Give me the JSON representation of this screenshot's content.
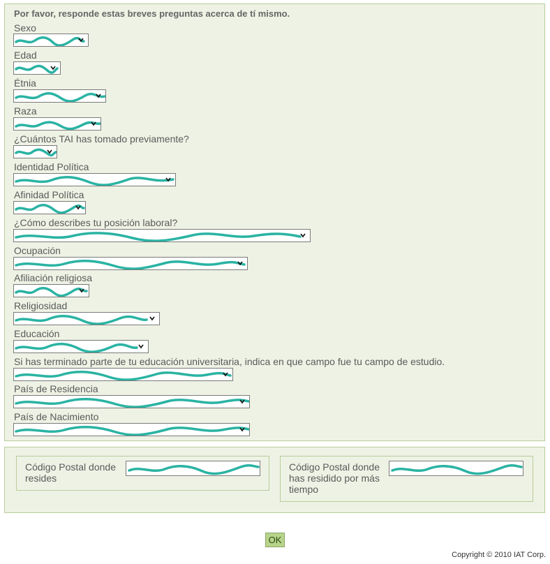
{
  "form": {
    "intro": "Por favor, responde estas breves preguntas acerca de tí mismo.",
    "questions": [
      {
        "label": "Sexo",
        "value": ""
      },
      {
        "label": "Edad",
        "value": ""
      },
      {
        "label": "Étnia",
        "value": ""
      },
      {
        "label": "Raza",
        "value": ""
      },
      {
        "label": "¿Cuántos TAI has tomado previamente?",
        "value": ""
      },
      {
        "label": "Identidad Política",
        "value": ""
      },
      {
        "label": "Afinidad Política",
        "value": ""
      },
      {
        "label": "¿Cómo describes tu posición laboral?",
        "value": ""
      },
      {
        "label": "Ocupación",
        "value": ""
      },
      {
        "label": "Afiliación religiosa",
        "value": ""
      },
      {
        "label": "Religiosidad",
        "value": ""
      },
      {
        "label": "Educación",
        "value": ""
      },
      {
        "label": "Si has terminado parte de tu educación universitaria, indica en que campo fue tu campo de estudio.",
        "value": ""
      },
      {
        "label": "País de Residencia",
        "value": ""
      },
      {
        "label": "País de Nacimiento",
        "value": ""
      }
    ]
  },
  "zip": {
    "current_label": "Código Postal donde resides",
    "longest_label": "Código Postal donde has residido por más tiempo",
    "current_value": "",
    "longest_value": ""
  },
  "buttons": {
    "ok_label": "OK"
  },
  "footer": {
    "copyright": "Copyright © 2010 IAT Corp."
  },
  "colors": {
    "panel_background": "#eef2e4",
    "panel_border": "#b8cc9b",
    "redaction_scribble": "#2ab3a3",
    "ok_button": "#b8d48a"
  },
  "icons": {
    "dropdown": "chevron-down-icon"
  }
}
